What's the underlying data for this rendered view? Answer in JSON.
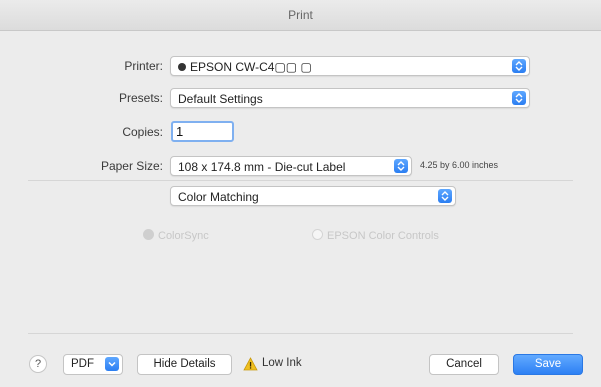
{
  "window": {
    "title": "Print"
  },
  "printer": {
    "label": "Printer:",
    "value": "EPSON CW-C4▢▢ ▢"
  },
  "presets": {
    "label": "Presets:",
    "value": "Default Settings"
  },
  "copies": {
    "label": "Copies:",
    "value": "1"
  },
  "paper_size": {
    "label": "Paper Size:",
    "value": "108 x 174.8 mm - Die-cut Label",
    "note": "4.25 by 6.00 inches"
  },
  "panel": {
    "value": "Color Matching"
  },
  "color_options": [
    {
      "label": "ColorSync",
      "selected": true
    },
    {
      "label": "EPSON Color Controls",
      "selected": false
    }
  ],
  "footer": {
    "help_label": "?",
    "pdf_label": "PDF",
    "hide_details_label": "Hide Details",
    "low_ink_label": "Low Ink",
    "cancel_label": "Cancel",
    "save_label": "Save"
  },
  "colors": {
    "accent": "#2d80f4",
    "warning": "#f0c020"
  }
}
